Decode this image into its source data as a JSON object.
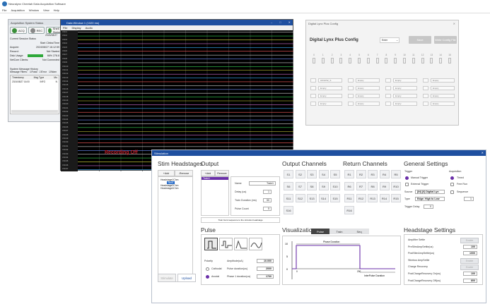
{
  "app": {
    "title": "Neuralynx Cheetah Data Acquisition Software",
    "menu": [
      "File",
      "Acquisition",
      "Window",
      "View",
      "Help"
    ]
  },
  "status_window": {
    "title": "Acquisition System Status",
    "buttons": [
      "ACQ",
      "REC",
      "Shell Status"
    ],
    "session_date": "2024/08/27",
    "rows": [
      {
        "k": "Current Session Status",
        "v": ""
      },
      {
        "k": "",
        "v": "Start Clinks/Time"
      },
      {
        "k": "Acquire:",
        "v": "2024/08/27 16:12:59"
      },
      {
        "k": "Record:",
        "v": "Not Started"
      },
      {
        "k": "Disk Usage:",
        "v": "66%  278.8"
      },
      {
        "k": "NetCom Clients:",
        "v": "Not Connected"
      }
    ],
    "history_title": "System Message History",
    "filters_label": "Message Filters:",
    "filters": [
      "Fatal",
      "Error",
      "Warn"
    ],
    "table_headers": [
      "Timestamp",
      "Msg Type",
      "Mo"
    ],
    "table_row": [
      "2024/08/27 16:00",
      "INFO",
      "N"
    ]
  },
  "data_window": {
    "title": "Data Window 1 (1020 ms)",
    "menu": [
      "File",
      "Display",
      "Audio"
    ],
    "labels": [
      "CSC1",
      "CSC2",
      "CSC3",
      "CSC4",
      "CSC5",
      "CSC6",
      "CSC7",
      "CSC8",
      "CSC9",
      "CSC10",
      "CSC11",
      "CSC12",
      "CSC13",
      "CSC14",
      "CSC15",
      "CSC16",
      "CSC17",
      "CSC18",
      "CSC19",
      "CSC20",
      "CSC21",
      "CSC22",
      "CSC23",
      "CSC24",
      "CSC25",
      "CSC26",
      "CSC27",
      "CSC28",
      "CSC29",
      "CSC30",
      "CSC31",
      "CSC32",
      "CSC33",
      "CSC34",
      "CSC35",
      "CSC36",
      "CSC37"
    ],
    "recording_text": "Recording Off",
    "trace_colors": [
      "#cfcfcf",
      "#39d353",
      "#e0e040",
      "#d070d0",
      "#3fb0ff",
      "#ff6060",
      "#ffffff",
      "#7090ff"
    ]
  },
  "lynx_config": {
    "title": "Digital Lynx Plus Config",
    "heading": "Digital Lynx Plus Config",
    "dropdown": "Enter",
    "buttons": [
      "Save",
      "Write Config File"
    ],
    "channel_numbers": [
      "0",
      "1",
      "2",
      "3",
      "4",
      "5",
      "6",
      "7",
      "8",
      "9",
      "10",
      "11",
      "12",
      "13",
      "14",
      "15"
    ],
    "slots": [
      "HS32/32_S",
      "Empty",
      "Empty",
      "Empty",
      "Empty",
      "Empty",
      "Empty",
      "Empty",
      "Empty",
      "Empty",
      "Empty",
      "Empty",
      "Empty",
      "Empty",
      "Empty",
      "Empty"
    ]
  },
  "stim": {
    "title": "Stimulation",
    "headstages": {
      "heading": "Stim Headstages",
      "add": "+Add",
      "remove": "-Remove",
      "tree": [
        "Headstage1Chm",
        "Stim1",
        "Headstage2Chm",
        "Headstage4Chm"
      ],
      "stimulate": "Stimulate",
      "upload": "Upload"
    },
    "output": {
      "heading": "Output",
      "add": "+Add",
      "remove": "Remove",
      "items": [
        "Train1"
      ],
      "note": "Train burst sequence to the stimulus headstage",
      "fields": [
        {
          "label": "Name",
          "value": "Train1"
        },
        {
          "label": "Delay (us)",
          "value": "1"
        },
        {
          "label": "Train Duration (ms)",
          "value": "50"
        },
        {
          "label": "Pulse Count",
          "value": "5"
        }
      ]
    },
    "output_channels": {
      "heading": "Output Channels",
      "channels": [
        "S1",
        "S2",
        "S3",
        "S4",
        "S5",
        "S6",
        "S7",
        "S8",
        "S9",
        "S10",
        "S11",
        "S12",
        "S13",
        "S14",
        "S15",
        "S16"
      ]
    },
    "return_channels": {
      "heading": "Return Channels",
      "channels": [
        "R1",
        "R2",
        "R3",
        "R4",
        "R5",
        "R6",
        "R7",
        "R8",
        "R9",
        "R10",
        "R11",
        "R12",
        "R13",
        "R14",
        "R15",
        "R16"
      ]
    },
    "general": {
      "heading": "General Settings",
      "trigger_label": "Trigger",
      "acq_label": "Acquisition",
      "trig_options": [
        "Manual Trigger",
        "External Trigger"
      ],
      "acq_options": [
        "Timed",
        "Free Run"
      ],
      "source_label": "Source",
      "source_value": "[IN] [0] Digital Lyn",
      "type_label": "Type",
      "type_value": "Edge: High to Low",
      "sequence_label": "Sequence",
      "sequence_value": "1",
      "trigger_delay_label": "Trigger Delay",
      "trigger_delay_value": "0"
    },
    "pulse": {
      "heading": "Pulse",
      "polarity_label": "Polarity",
      "polarity": [
        "Cathodal",
        "Anodal"
      ],
      "fields": [
        {
          "label": "Amplitude(uA)",
          "value": "10.000"
        },
        {
          "label": "Pulse duration(us)",
          "value": "2000"
        },
        {
          "label": "Phase 1 duration(us)",
          "value": "1700"
        }
      ]
    },
    "visualization": {
      "heading": "Visualization",
      "tabs": [
        "Pulse",
        "Train",
        "Seq"
      ],
      "y_ticks": [
        "10",
        "5",
        "0"
      ],
      "x_ticks": [
        "0",
        "200"
      ],
      "phase_label": "Phase Duration",
      "interphase_label": "InterPulse Duration"
    },
    "headstage_settings": {
      "heading": "Headstage Settings",
      "rows": [
        {
          "label": "Amplifier Settle",
          "value": "Enable"
        },
        {
          "label": "PreStimAmpSettle(us)",
          "value": "100"
        },
        {
          "label": "PostStimAmpSettle(us)",
          "value": "1000"
        },
        {
          "label": "Stimbus AmpSettle",
          "value": "Enable"
        },
        {
          "label": "Charge Recovery",
          "value": "Enable"
        },
        {
          "label": "PostChargeRecovery On(us)",
          "value": "100"
        },
        {
          "label": "PostChargeRecovery Off(us)",
          "value": "800"
        }
      ]
    }
  }
}
